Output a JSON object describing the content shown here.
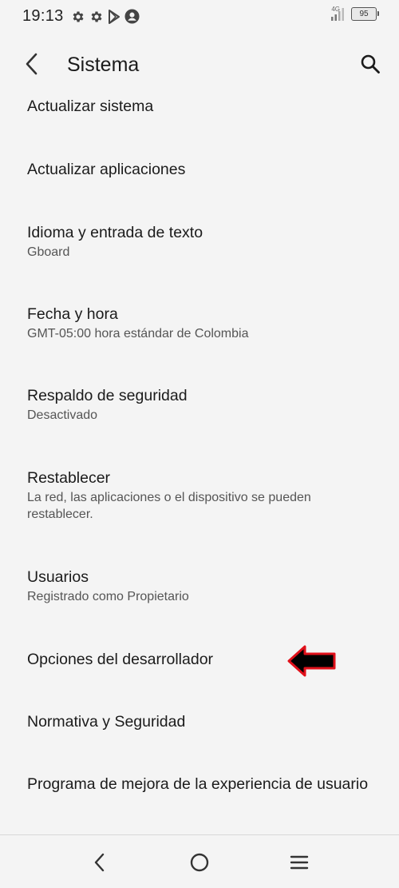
{
  "status_bar": {
    "time": "19:13",
    "network": "4G",
    "battery": "95",
    "icons": [
      "settings-icon",
      "settings-icon",
      "play-store-icon",
      "account-icon",
      "signal-icon",
      "battery-icon"
    ]
  },
  "header": {
    "title": "Sistema",
    "back_icon": "back-arrow-icon",
    "search_icon": "search-icon"
  },
  "settings": {
    "items": [
      {
        "title": "Actualizar sistema",
        "subtitle": ""
      },
      {
        "title": "Actualizar aplicaciones",
        "subtitle": ""
      },
      {
        "title": "Idioma y entrada de texto",
        "subtitle": "Gboard"
      },
      {
        "title": "Fecha y hora",
        "subtitle": "GMT-05:00 hora estándar de Colombia"
      },
      {
        "title": "Respaldo de seguridad",
        "subtitle": "Desactivado"
      },
      {
        "title": "Restablecer",
        "subtitle": "La red, las aplicaciones o el dispositivo se pueden restablecer."
      },
      {
        "title": "Usuarios",
        "subtitle": "Registrado como Propietario"
      },
      {
        "title": "Opciones del desarrollador",
        "subtitle": ""
      },
      {
        "title": "Normativa y Seguridad",
        "subtitle": ""
      },
      {
        "title": "Programa de mejora de la experiencia de usuario",
        "subtitle": ""
      }
    ]
  },
  "annotation": {
    "color": "#e0101a",
    "icon": "left-arrow-icon"
  },
  "nav_bar": {
    "icons": [
      "nav-back-icon",
      "nav-home-icon",
      "nav-menu-icon"
    ]
  }
}
